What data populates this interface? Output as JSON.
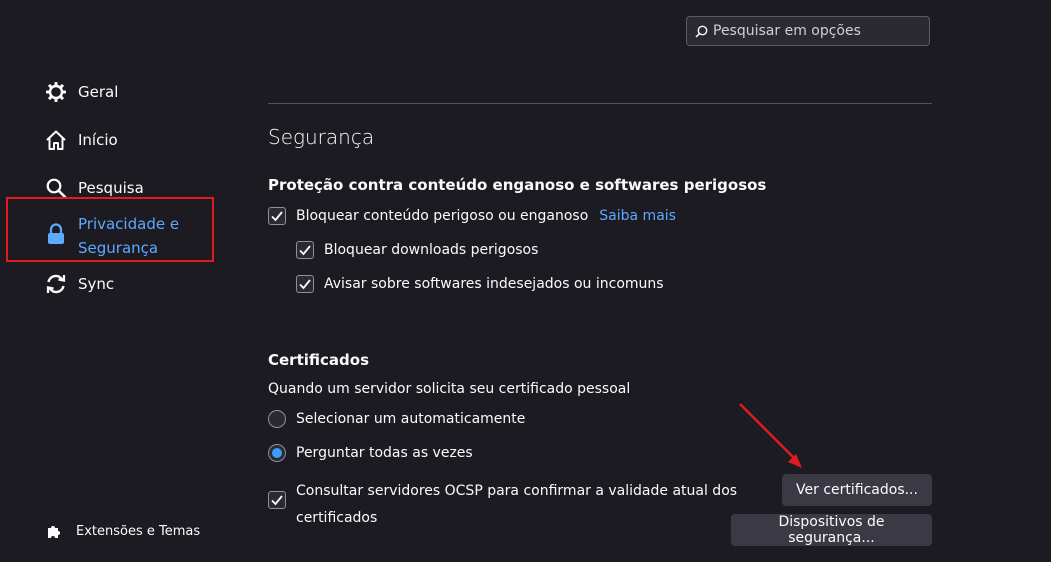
{
  "search": {
    "placeholder": "Pesquisar em opções"
  },
  "sidebar": {
    "items": [
      {
        "label": "Geral",
        "icon": "gear-icon"
      },
      {
        "label": "Início",
        "icon": "home-icon"
      },
      {
        "label": "Pesquisa",
        "icon": "search-icon"
      },
      {
        "label_line1": "Privacidade e",
        "label_line2": "Segurança",
        "icon": "lock-icon",
        "active": true
      },
      {
        "label": "Sync",
        "icon": "sync-icon"
      }
    ],
    "extensions_label": "Extensões e Temas"
  },
  "security": {
    "heading": "Segurança",
    "protection": {
      "title": "Proteção contra conteúdo enganoso e softwares perigosos",
      "block_dangerous_label": "Bloquear conteúdo perigoso ou enganoso",
      "learn_more": "Saiba mais",
      "block_downloads_label": "Bloquear downloads perigosos",
      "warn_unwanted_label": "Avisar sobre softwares indesejados ou incomuns"
    },
    "certificates": {
      "title": "Certificados",
      "prompt": "Quando um servidor solicita seu certificado pessoal",
      "radio_auto": "Selecionar um automaticamente",
      "radio_ask": "Perguntar todas as vezes",
      "ocsp_line1": "Consultar servidores OCSP para confirmar a validade atual dos",
      "ocsp_line2": "certificados",
      "view_certs_button": "Ver certificados...",
      "security_devices_button": "Dispositivos de segurança..."
    }
  },
  "colors": {
    "background": "#1c1b22",
    "accent": "#5ea8ff",
    "highlight": "#e01b24"
  }
}
